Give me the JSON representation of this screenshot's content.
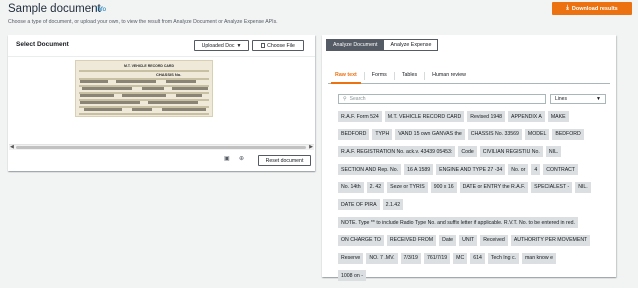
{
  "header": {
    "title": "Sample document",
    "info_label": "Info",
    "subtitle": "Choose a type of document, or upload your own, to view the result from Analyze Document or Analyze Expense APIs.",
    "download_label": "Download results",
    "download_icon": "download-icon",
    "accent_color": "#ec7211"
  },
  "left": {
    "title": "Select Document",
    "uploaded_doc_label": "Uploaded Doc",
    "choose_file_label": "Choose File",
    "reset_label": "Reset document",
    "scan_header": "M.T. VEHICLE RECORD CARD",
    "scan_chassis": "CHASSIS No."
  },
  "right": {
    "api_tabs": [
      "Analyze Document",
      "Analyze Expense"
    ],
    "active_api": "Analyze Document",
    "result_tabs": [
      "Raw text",
      "Forms",
      "Tables",
      "Human review"
    ],
    "active_result_tab": "Raw text",
    "search_placeholder": "Search",
    "view_select": "Lines",
    "chip_rows": [
      [
        "R.A.F. Form 524",
        "M.T. VEHICLE RECORD CARD",
        "Revised 1948",
        "APPENDIX A",
        "MAKE"
      ],
      [
        "BEDFORD",
        "TYPH",
        "VAND 15 own GANVAS the",
        "CHASSIS No. 33569",
        "MODEL",
        "BEDFORD"
      ],
      [
        "R.A.F. REGISTRATION No. ack.v. 43439 05453:",
        "Code",
        "CIVILIAN REGISTIU No.",
        "NIL."
      ],
      [
        "SECTION AND Rep. No.",
        "16 A 1589",
        "ENGINE AND TYPE 27 -34",
        "No. or",
        "4",
        "CONTRACT"
      ],
      [
        "No. 14th",
        "2. 42",
        "Seze or TYRIS",
        "900 x 16",
        "DATE or ENTRY the R.A.F.",
        "SPECIALEST -",
        "NIL."
      ],
      [
        "DATE OF PIRA",
        "2.1.42"
      ],
      [
        "NOTE. Type ** to include Radio Type No. and suffix letter if applicable. R.V.T. No. to be entered in red."
      ],
      [
        "ON CHARGE TO",
        "RECEIVED FROM",
        "Date",
        "UNIT",
        "Received",
        "AUTHORITY PER MOVEMENT"
      ],
      [
        "Reserve",
        "NO. 7 .MV.",
        "7/3/19",
        "761/7/19",
        "MC",
        "614",
        "Tech Ing c.",
        "man know e"
      ],
      [
        "1008 on -"
      ]
    ]
  }
}
